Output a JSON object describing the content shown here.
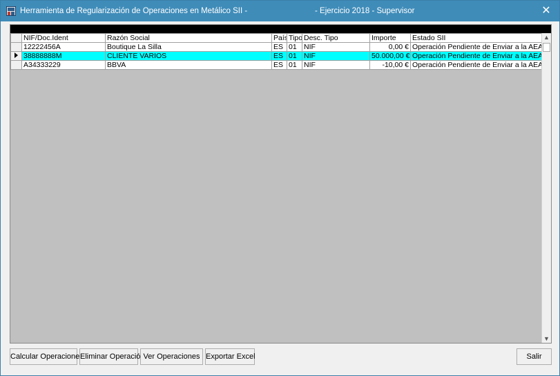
{
  "window": {
    "title": "Herramienta de Regularización de Operaciones en Metálico SII -",
    "subtitle": "- Ejercicio 2018 - Supervisor",
    "close_label": "✕"
  },
  "grid": {
    "columns": [
      "NIF/Doc.Ident",
      "Razón Social",
      "País",
      "Tipo",
      "Desc. Tipo",
      "Importe",
      "Estado SII"
    ],
    "rows": [
      {
        "nif": "12222456A",
        "razon": "Boutique La Silla",
        "pais": "ES",
        "tipo": "01",
        "desc": "NIF",
        "importe": "0,00 €",
        "estado": "Operación Pendiente de Enviar a la AEAT"
      },
      {
        "nif": "38888888M",
        "razon": "CLIENTE VARIOS",
        "pais": "ES",
        "tipo": "01",
        "desc": "NIF",
        "importe": "50.000,00 €",
        "estado": "Operación Pendiente de Enviar a la AEAT"
      },
      {
        "nif": "A34333229",
        "razon": "BBVA",
        "pais": "ES",
        "tipo": "01",
        "desc": "NIF",
        "importe": "-10,00 €",
        "estado": "Operación Pendiente de Enviar a la AEAT"
      }
    ],
    "selected_row": 1,
    "selection_color": "#00ffff"
  },
  "buttons": {
    "calcular": "Calcular Operaciones",
    "eliminar": "Eliminar Operación",
    "ver": "Ver Operaciones",
    "exportar": "Exportar Excel",
    "salir": "Salir"
  },
  "colors": {
    "titlebar": "#3f8cb9",
    "grid_bg": "#c0c0c0"
  },
  "icons": {
    "app": "app-logo-icon",
    "row_pointer": "row-pointer-icon",
    "close": "close-icon"
  }
}
